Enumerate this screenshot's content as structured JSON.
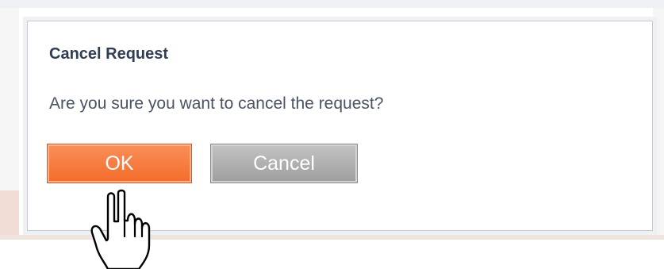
{
  "dialog": {
    "title": "Cancel Request",
    "message": "Are you sure you want to cancel the request?",
    "ok_label": "OK",
    "cancel_label": "Cancel"
  },
  "colors": {
    "ok_button": "#f36c2b",
    "cancel_button": "#9e9e9e",
    "title_text": "#2f3e52",
    "message_text": "#4a5464"
  },
  "icons": {
    "cursor": "hand-pointer-icon"
  }
}
